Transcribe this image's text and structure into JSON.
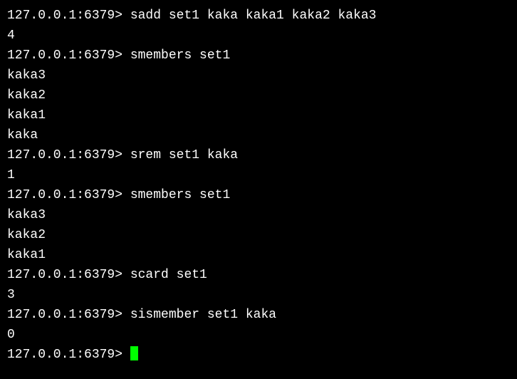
{
  "terminal": {
    "prompt": "127.0.0.1:6379> ",
    "lines": [
      {
        "prompt": true,
        "text": "sadd set1 kaka kaka1 kaka2 kaka3"
      },
      {
        "prompt": false,
        "text": "4"
      },
      {
        "prompt": true,
        "text": "smembers set1"
      },
      {
        "prompt": false,
        "text": "kaka3"
      },
      {
        "prompt": false,
        "text": "kaka2"
      },
      {
        "prompt": false,
        "text": "kaka1"
      },
      {
        "prompt": false,
        "text": "kaka"
      },
      {
        "prompt": true,
        "text": "srem set1 kaka"
      },
      {
        "prompt": false,
        "text": "1"
      },
      {
        "prompt": true,
        "text": "smembers set1"
      },
      {
        "prompt": false,
        "text": "kaka3"
      },
      {
        "prompt": false,
        "text": "kaka2"
      },
      {
        "prompt": false,
        "text": "kaka1"
      },
      {
        "prompt": true,
        "text": "scard set1"
      },
      {
        "prompt": false,
        "text": "3"
      },
      {
        "prompt": true,
        "text": "sismember set1 kaka"
      },
      {
        "prompt": false,
        "text": "0"
      }
    ],
    "current_input": ""
  }
}
